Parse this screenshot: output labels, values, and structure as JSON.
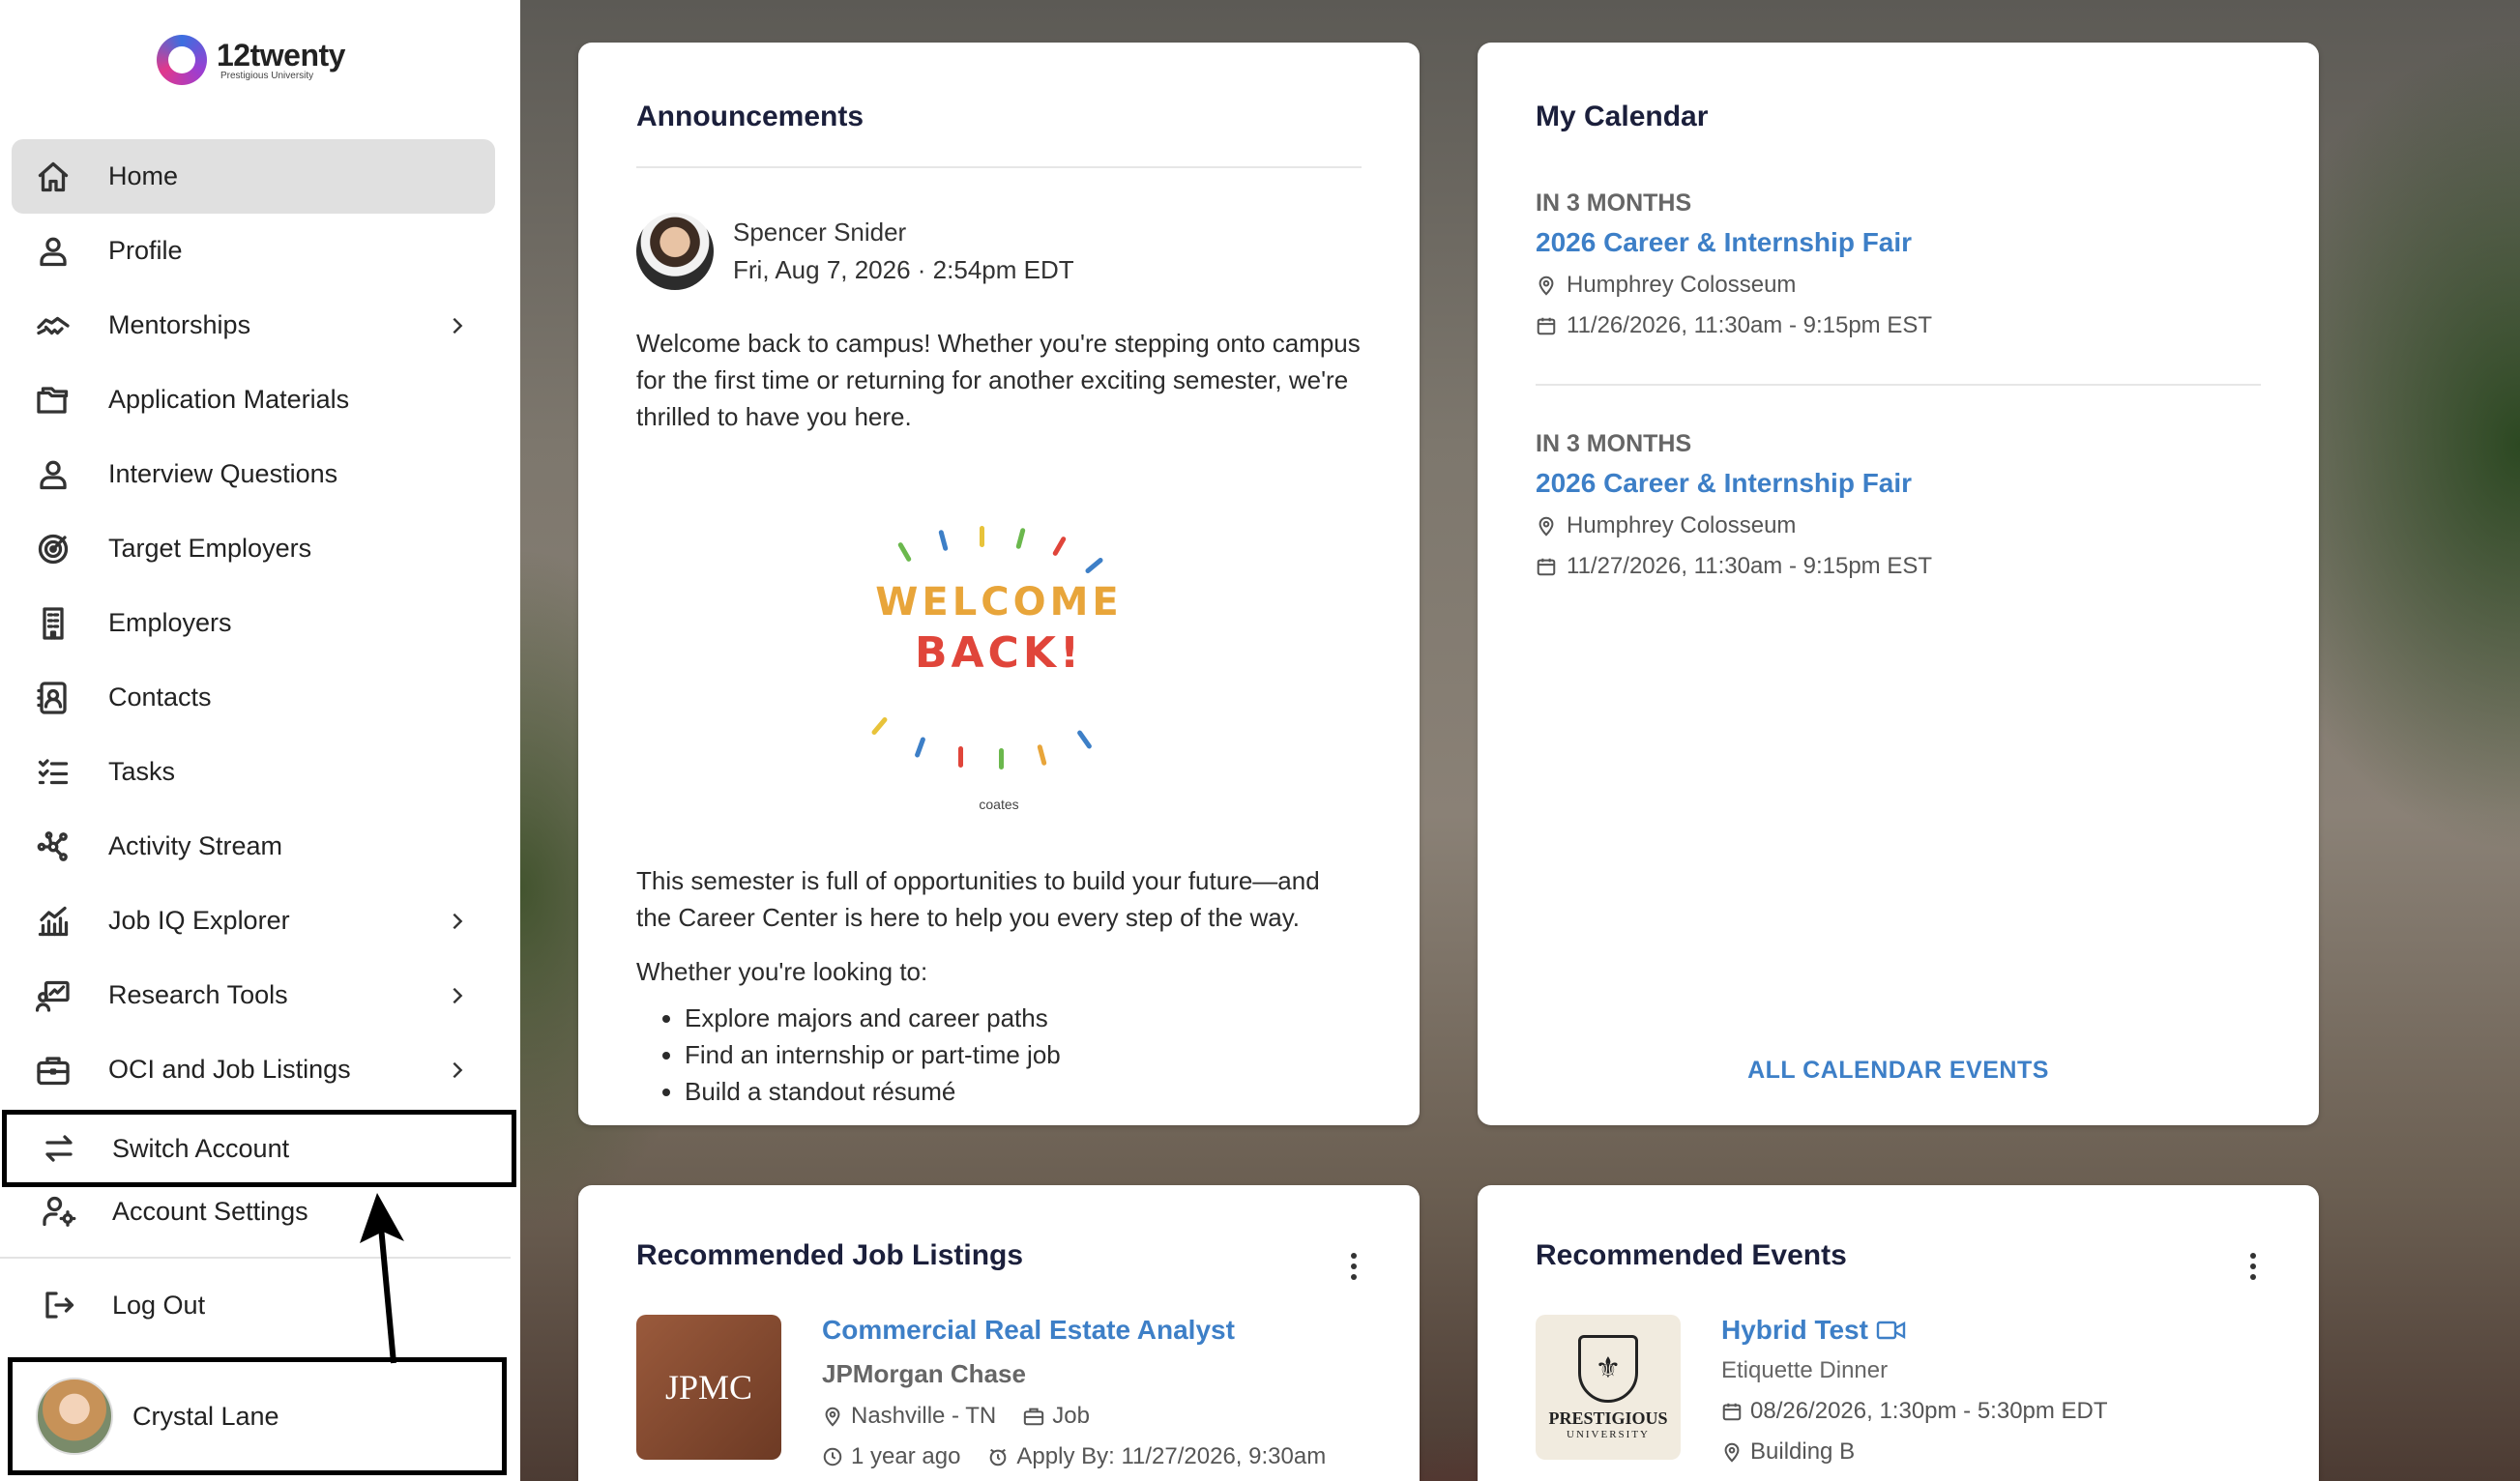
{
  "brand": {
    "name": "12twenty",
    "subtitle": "Prestigious University"
  },
  "sidebar": {
    "items": [
      {
        "label": "Home",
        "icon": "home-icon",
        "active": true,
        "has_submenu": false
      },
      {
        "label": "Profile",
        "icon": "user-icon",
        "has_submenu": false
      },
      {
        "label": "Mentorships",
        "icon": "handshake-icon",
        "has_submenu": true
      },
      {
        "label": "Application Materials",
        "icon": "folder-icon",
        "has_submenu": false
      },
      {
        "label": "Interview Questions",
        "icon": "user-icon",
        "has_submenu": false
      },
      {
        "label": "Target Employers",
        "icon": "target-icon",
        "has_submenu": false
      },
      {
        "label": "Employers",
        "icon": "building-icon",
        "has_submenu": false
      },
      {
        "label": "Contacts",
        "icon": "contact-card-icon",
        "has_submenu": false
      },
      {
        "label": "Tasks",
        "icon": "checklist-icon",
        "has_submenu": false
      },
      {
        "label": "Activity Stream",
        "icon": "network-icon",
        "has_submenu": false
      },
      {
        "label": "Job IQ Explorer",
        "icon": "bar-chart-icon",
        "has_submenu": true
      },
      {
        "label": "Research Tools",
        "icon": "research-icon",
        "has_submenu": true
      },
      {
        "label": "OCI and Job Listings",
        "icon": "briefcase-icon",
        "has_submenu": true
      }
    ],
    "account_menu": {
      "switch_account": "Switch Account",
      "account_settings": "Account Settings",
      "log_out": "Log Out"
    },
    "user": {
      "name": "Crystal Lane"
    }
  },
  "announcements": {
    "title": "Announcements",
    "author": "Spencer Snider",
    "date": "Fri, Aug 7, 2026",
    "time": "2:54pm EDT",
    "paragraph1": "Welcome back to campus! Whether you're stepping onto campus for the first time or returning for another exciting semester, we're thrilled to have you here.",
    "image_line1": "WELCOME",
    "image_line2": "BACK!",
    "image_credit": "coates",
    "paragraph2": "This semester is full of opportunities to build your future—and the Career Center is here to help you every step of the way.",
    "paragraph3": "Whether you're looking to:",
    "bullets": [
      "Explore majors and career paths",
      "Find an internship or part-time job",
      "Build a standout résumé"
    ]
  },
  "calendar": {
    "title": "My Calendar",
    "events": [
      {
        "when": "IN 3 MONTHS",
        "title": "2026 Career & Internship Fair",
        "location": "Humphrey Colosseum",
        "datetime": "11/26/2026, 11:30am - 9:15pm EST"
      },
      {
        "when": "IN 3 MONTHS",
        "title": "2026 Career & Internship Fair",
        "location": "Humphrey Colosseum",
        "datetime": "11/27/2026, 11:30am - 9:15pm EST"
      }
    ],
    "all_events_label": "ALL CALENDAR EVENTS"
  },
  "recommended_jobs": {
    "title": "Recommended Job Listings",
    "job": {
      "title": "Commercial Real Estate Analyst",
      "company": "JPMorgan Chase",
      "logo_text": "JPMC",
      "location": "Nashville - TN",
      "type": "Job",
      "posted": "1 year ago",
      "apply_by": "Apply By: 11/27/2026, 9:30am"
    }
  },
  "recommended_events": {
    "title": "Recommended Events",
    "event": {
      "title": "Hybrid Test",
      "subtitle": "Etiquette Dinner",
      "logo_line1": "PRESTIGIOUS",
      "logo_line2": "UNIVERSITY",
      "datetime": "08/26/2026, 1:30pm - 5:30pm EDT",
      "location": "Building B"
    }
  },
  "colors": {
    "link": "#3d7fc7",
    "active_nav": "#e0e0e0",
    "title": "#1b1f3b"
  }
}
